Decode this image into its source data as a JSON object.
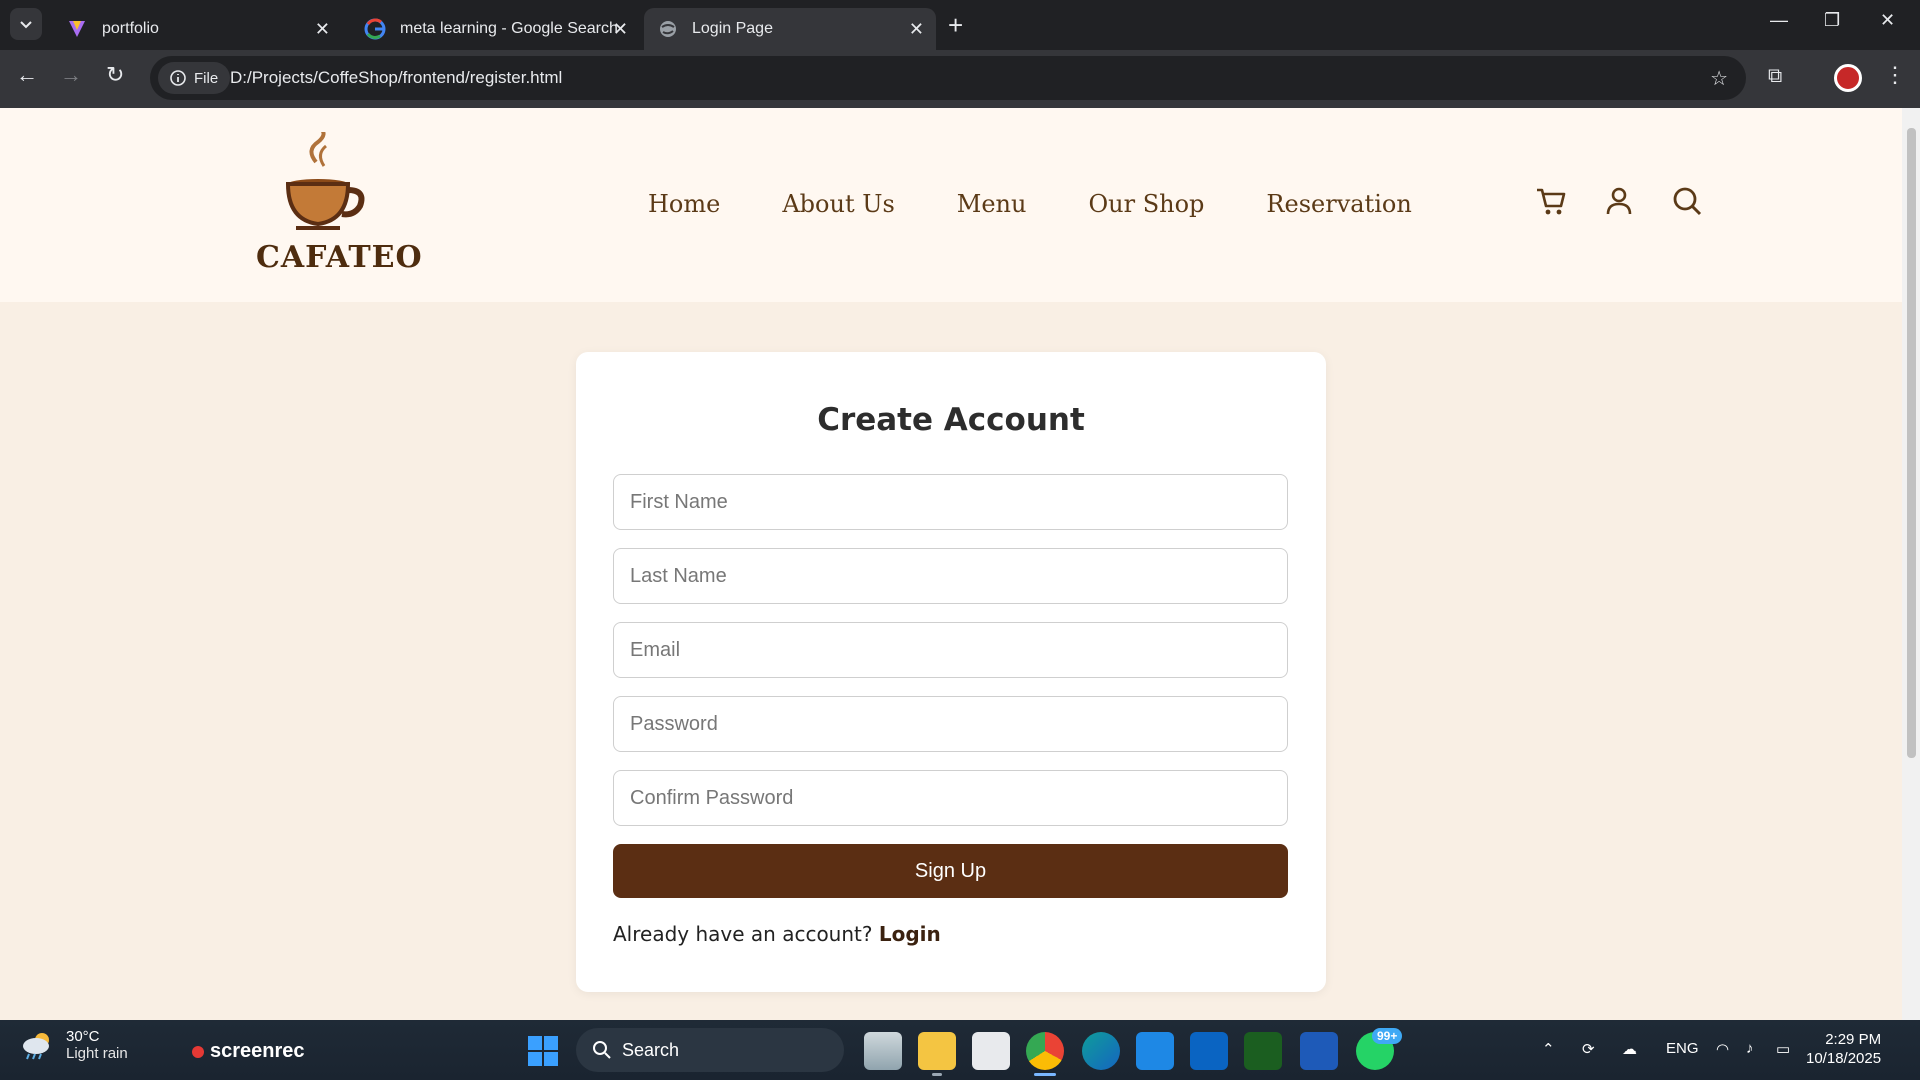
{
  "browser": {
    "tabs": [
      {
        "title": "portfolio",
        "icon": "portfolio-favicon"
      },
      {
        "title": "meta learning - Google Search",
        "icon": "google-icon"
      },
      {
        "title": "Login Page",
        "icon": "globe-icon",
        "active": true
      }
    ],
    "file_label": "File",
    "url": "D:/Projects/CoffeShop/frontend/register.html"
  },
  "site": {
    "brand": "CAFATEO",
    "nav": [
      "Home",
      "About Us",
      "Menu",
      "Our Shop",
      "Reservation"
    ],
    "header_icons": [
      "cart-icon",
      "user-icon",
      "search-icon"
    ]
  },
  "form": {
    "title": "Create Account",
    "first_name_placeholder": "First Name",
    "last_name_placeholder": "Last Name",
    "email_placeholder": "Email",
    "password_placeholder": "Password",
    "confirm_password_placeholder": "Confirm Password",
    "submit_label": "Sign Up",
    "already_text": "Already have an account?",
    "login_link": "Login"
  },
  "taskbar": {
    "weather_temp": "30°C",
    "weather_desc": "Light rain",
    "screenrec_label": "screenrec",
    "search_label": "Search",
    "notification_badge": "99+",
    "language": "ENG",
    "time": "2:29 PM",
    "date": "10/18/2025"
  },
  "colors": {
    "accent": "#5b2e13",
    "page_bg": "#f9efe4",
    "header_bg": "#fff8f1",
    "nav_text": "#5b3a17"
  }
}
